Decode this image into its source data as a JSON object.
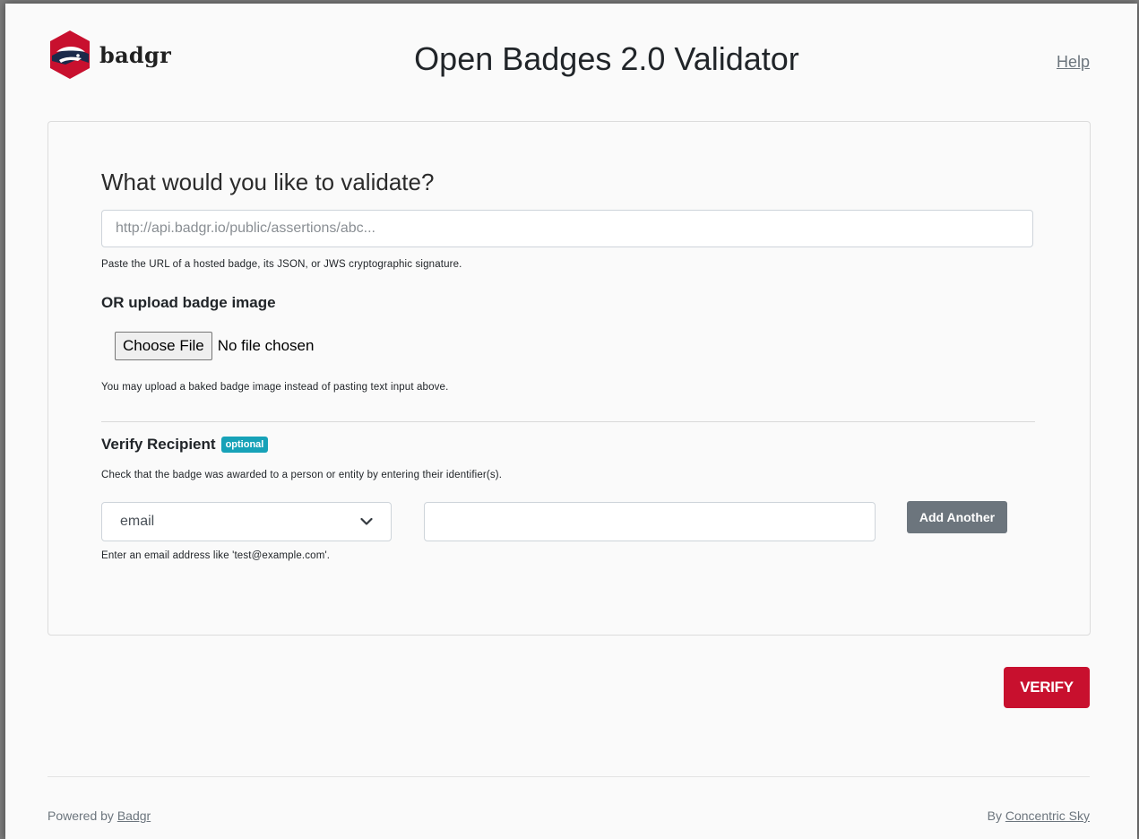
{
  "brand": {
    "logo_text": "badgr",
    "logo_icon": "badger-shield-icon",
    "logo_colors": {
      "shield": "#c8102e",
      "stripe": "#1b2a4a",
      "face": "#ffffff"
    }
  },
  "header": {
    "title": "Open Badges 2.0 Validator",
    "help_label": "Help"
  },
  "form": {
    "question": "What would you like to validate?",
    "url_placeholder": "http://api.badgr.io/public/assertions/abc...",
    "url_help": "Paste the URL of a hosted badge, its JSON, or JWS cryptographic signature.",
    "upload_title": "OR upload badge image",
    "choose_file_label": "Choose File",
    "file_status": "No file chosen",
    "upload_help": "You may upload a baked badge image instead of pasting text input above.",
    "recipient": {
      "title": "Verify Recipient",
      "optional_badge": "optional",
      "description": "Check that the badge was awarded to a person or entity by entering their identifier(s).",
      "identifier_type_selected": "email",
      "identifier_value": "",
      "add_another_label": "Add Another",
      "identifier_help": "Enter an email address like 'test@example.com'."
    },
    "verify_label": "VERIFY"
  },
  "footer": {
    "left_prefix": "Powered by",
    "left_link": "Badgr",
    "right_prefix": "By",
    "right_link": "Concentric Sky"
  },
  "colors": {
    "primary": "#c8102e",
    "secondary": "#6c757d",
    "badge_info": "#17a2b8",
    "background": "#fafafa"
  }
}
